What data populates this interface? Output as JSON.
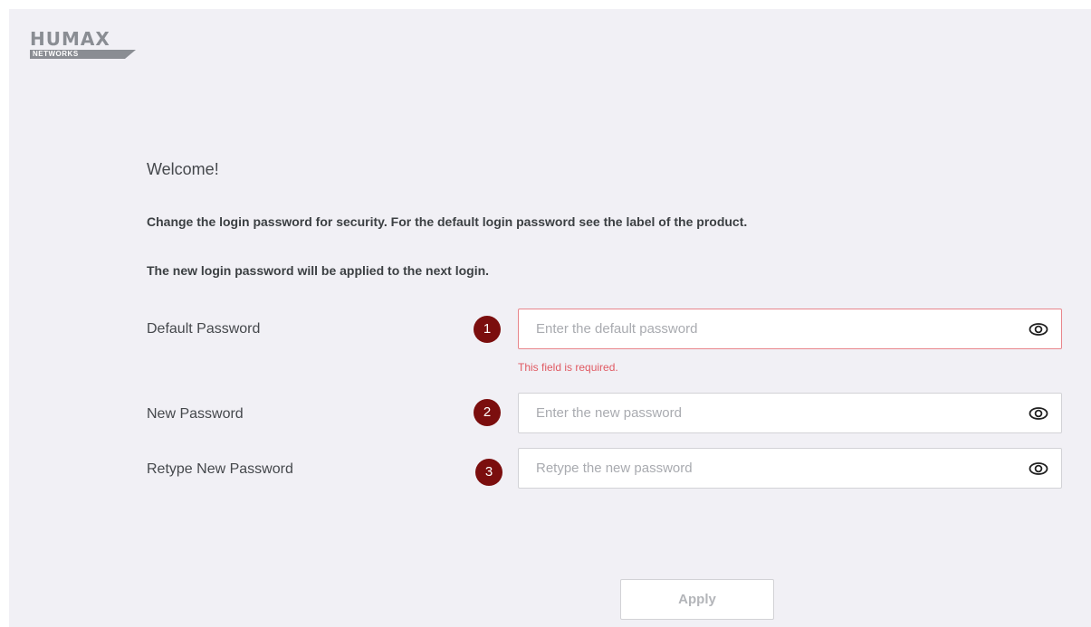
{
  "brand": {
    "name": "HUMAX",
    "sub": "NETWORKS"
  },
  "welcome": "Welcome!",
  "description": [
    "Change the login password for security. For the default login password see the label of the product.",
    "The new login password will be applied to the next login."
  ],
  "fields": [
    {
      "step": "1",
      "label": "Default Password",
      "placeholder": "Enter the default password",
      "value": "",
      "error": "This field is required."
    },
    {
      "step": "2",
      "label": "New Password",
      "placeholder": "Enter the new password",
      "value": ""
    },
    {
      "step": "3",
      "label": "Retype New Password",
      "placeholder": "Retype the new password",
      "value": ""
    }
  ],
  "apply_label": "Apply",
  "colors": {
    "background": "#f1f0f5",
    "badge": "#7b0e0e",
    "error": "#e05a63",
    "error_border": "#e8858b"
  },
  "icons": {
    "show_password": "eye-icon"
  }
}
